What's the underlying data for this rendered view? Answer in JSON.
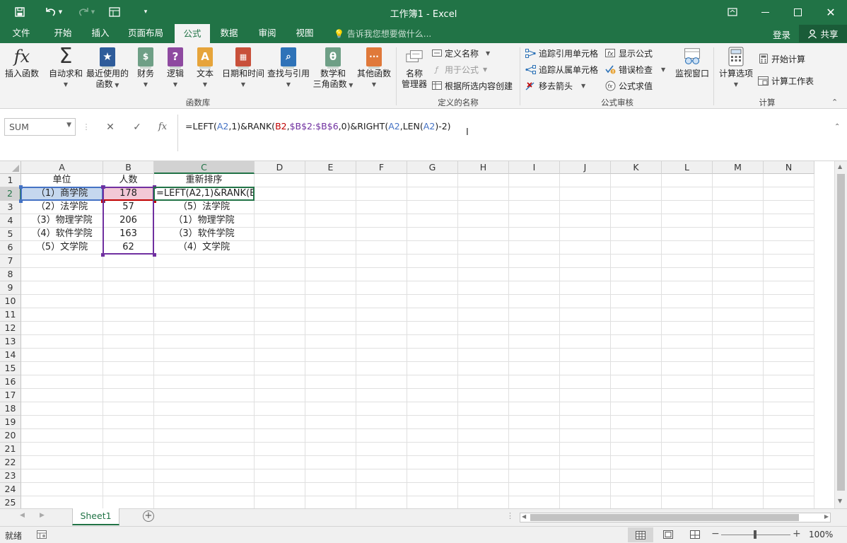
{
  "window": {
    "title": "工作簿1 - Excel"
  },
  "menu": {
    "tabs": [
      "文件",
      "开始",
      "插入",
      "页面布局",
      "公式",
      "数据",
      "审阅",
      "视图"
    ],
    "active_tab": "公式",
    "tell_me": "告诉我您想要做什么...",
    "login": "登录",
    "share": "共享"
  },
  "ribbon": {
    "function_library": {
      "group_label": "函数库",
      "buttons": [
        {
          "label": "插入函数",
          "icon": "fx-icon"
        },
        {
          "label": "自动求和",
          "icon": "sigma-icon"
        },
        {
          "label": "最近使用的",
          "label2": "函数",
          "icon": "recent-functions-icon"
        },
        {
          "label": "财务",
          "icon": "financial-icon"
        },
        {
          "label": "逻辑",
          "icon": "logical-icon"
        },
        {
          "label": "文本",
          "icon": "text-icon"
        },
        {
          "label": "日期和时间",
          "icon": "date-time-icon"
        },
        {
          "label": "查找与引用",
          "icon": "lookup-icon"
        },
        {
          "label": "数学和",
          "label2": "三角函数",
          "icon": "math-trig-icon"
        },
        {
          "label": "其他函数",
          "icon": "more-functions-icon"
        }
      ]
    },
    "defined_names": {
      "group_label": "定义的名称",
      "name_manager": "名称",
      "name_manager2": "管理器",
      "define_name": "定义名称",
      "use_in_formula": "用于公式",
      "create_from_selection": "根据所选内容创建"
    },
    "formula_auditing": {
      "group_label": "公式审核",
      "trace_precedents": "追踪引用单元格",
      "trace_dependents": "追踪从属单元格",
      "remove_arrows": "移去箭头",
      "show_formulas": "显示公式",
      "error_checking": "错误检查",
      "evaluate_formula": "公式求值",
      "watch_window": "监视窗口"
    },
    "calculation": {
      "group_label": "计算",
      "calc_options": "计算选项",
      "calc_now": "开始计算",
      "calc_sheet": "计算工作表"
    }
  },
  "formula_bar": {
    "name_box": "SUM",
    "formula_parts": [
      {
        "t": "=LEFT(",
        "c": ""
      },
      {
        "t": "A2",
        "c": "r1"
      },
      {
        "t": ",1)&RANK(",
        "c": ""
      },
      {
        "t": "B2",
        "c": "r2"
      },
      {
        "t": ",",
        "c": ""
      },
      {
        "t": "$B$2:$B$6",
        "c": "r3"
      },
      {
        "t": ",0)&RIGHT(",
        "c": ""
      },
      {
        "t": "A2",
        "c": "r1"
      },
      {
        "t": ",LEN(",
        "c": ""
      },
      {
        "t": "A2",
        "c": "r1"
      },
      {
        "t": ")-2)",
        "c": ""
      }
    ]
  },
  "sheet": {
    "columns": [
      "A",
      "B",
      "C",
      "D",
      "E",
      "F",
      "G",
      "H",
      "I",
      "J",
      "K",
      "L",
      "M",
      "N"
    ],
    "rows": [
      "1",
      "2",
      "3",
      "4",
      "5",
      "6",
      "7",
      "8",
      "9",
      "10",
      "11",
      "12",
      "13",
      "14",
      "15",
      "16",
      "17",
      "18",
      "19",
      "20",
      "21",
      "22",
      "23",
      "24",
      "25"
    ],
    "active_cell": "C2",
    "cells": {
      "A1": "单位",
      "B1": "人数",
      "C1": "重新排序",
      "A2": "（1）商学院",
      "B2": "178",
      "C2": "=LEFT(A2,1)&RANK(B",
      "A3": "（2）法学院",
      "B3": "57",
      "C3": "（5）法学院",
      "A4": "（3）物理学院",
      "B4": "206",
      "C4": "（1）物理学院",
      "A5": "（4）软件学院",
      "B5": "163",
      "C5": "（3）软件学院",
      "A6": "（5）文学院",
      "B6": "62",
      "C6": "（4）文学院"
    },
    "tab": "Sheet1"
  },
  "status": {
    "ready": "就绪",
    "zoom": "100%"
  }
}
